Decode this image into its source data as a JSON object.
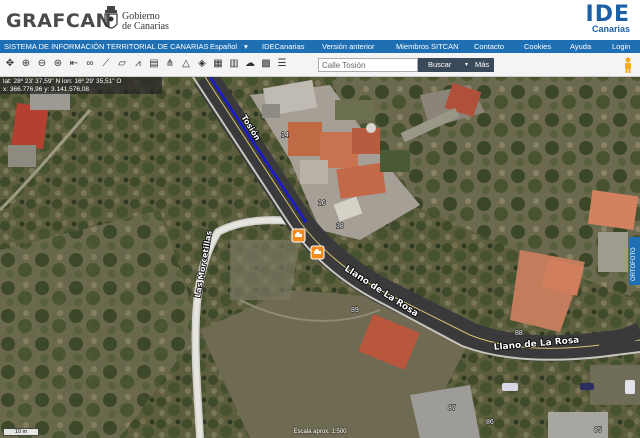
{
  "header": {
    "brand": "GRAFCAN",
    "gov_line1": "Gobierno",
    "gov_line2": "de Canarias",
    "ide_big": "IDE",
    "ide_small": "Canarias"
  },
  "navbar": {
    "title": "SISTEMA DE INFORMACIÓN TERRITORIAL DE CANARIAS",
    "language": "Español",
    "language_caret": "▾",
    "items": [
      "IDECanarias",
      "Versión anterior",
      "Miembros SITCAN",
      "Contacto",
      "Cookies",
      "Ayuda",
      "Login"
    ]
  },
  "toolbar": {
    "tools": [
      {
        "name": "pan-icon",
        "glyph": "✥"
      },
      {
        "name": "zoom-in-icon",
        "glyph": "⊕"
      },
      {
        "name": "zoom-out-icon",
        "glyph": "⊖"
      },
      {
        "name": "globe-icon",
        "glyph": "⊛"
      },
      {
        "name": "full-extent-icon",
        "glyph": "⇤"
      },
      {
        "name": "link-icon",
        "glyph": "∞"
      },
      {
        "name": "measure-icon",
        "glyph": "⟋"
      },
      {
        "name": "ruler-icon",
        "glyph": "▱"
      },
      {
        "name": "profile-icon",
        "glyph": "⩘"
      },
      {
        "name": "print-icon",
        "glyph": "▤"
      },
      {
        "name": "route-icon",
        "glyph": "⋔"
      },
      {
        "name": "triangle-icon",
        "glyph": "△"
      },
      {
        "name": "layers-icon",
        "glyph": "◈"
      },
      {
        "name": "3d-view-icon",
        "glyph": "▦"
      },
      {
        "name": "building-icon",
        "glyph": "▥"
      },
      {
        "name": "cloud-icon",
        "glyph": "☁"
      },
      {
        "name": "grid-icon",
        "glyph": "▩"
      },
      {
        "name": "list-icon",
        "glyph": "☰"
      }
    ],
    "search_value": "Calle Tosión",
    "search_button": "Buscar",
    "search_caret": "▾",
    "more_label": "Más"
  },
  "map": {
    "coords_line1": "lat: 28º 23' 37,59\" N  lon: 16º 29' 35,51\" O",
    "coords_line2": "x: 366.776,96  y: 3.141.576,08",
    "streets": [
      "Tosión",
      "Llano de La Rosa",
      "Llano de La Rosa",
      "Las Morcetillas"
    ],
    "numbers": [
      "14",
      "16",
      "18",
      "89",
      "88",
      "87",
      "86",
      "85"
    ],
    "scale_left": "10 m",
    "scale_center": "Escala aprox. 1:500",
    "side_tab": "ORTOFOTO",
    "accent": "#1f6fb5",
    "poi_color": "#f28c1e",
    "road_color": "#3a3a3c",
    "selection_color": "#1a1ad0"
  }
}
